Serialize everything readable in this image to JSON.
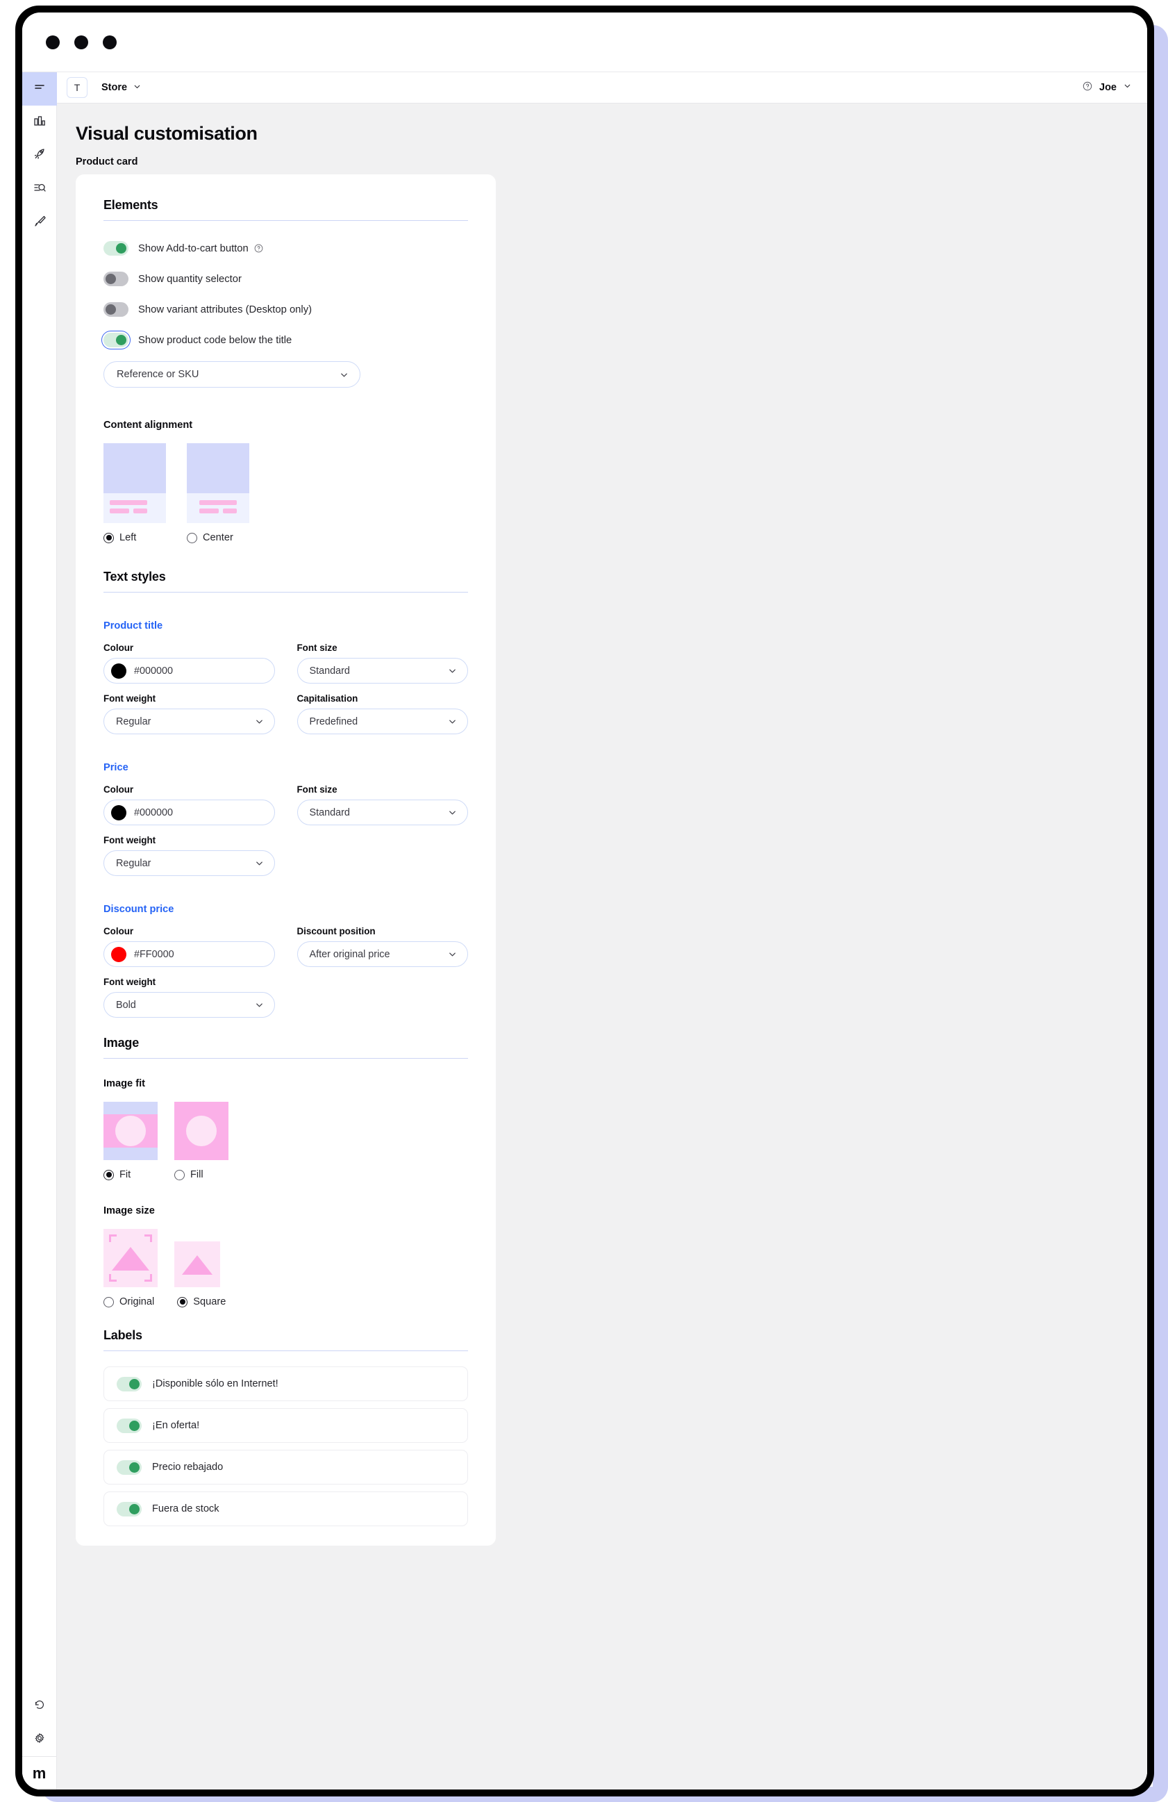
{
  "browser": {
    "dots": 3
  },
  "topbar": {
    "store_initial": "T",
    "store_label": "Store",
    "user_name": "Joe",
    "help_icon": "question-circle-icon",
    "chevron_icon": "chevron-down-icon"
  },
  "rail": {
    "items": [
      {
        "icon": "menu-icon",
        "active": true
      },
      {
        "icon": "bar-chart-icon",
        "active": false
      },
      {
        "icon": "rocket-icon",
        "active": false
      },
      {
        "icon": "search-list-icon",
        "active": false
      },
      {
        "icon": "paintbrush-icon",
        "active": false
      }
    ],
    "bottom": [
      {
        "icon": "history-icon"
      },
      {
        "icon": "gear-icon"
      }
    ],
    "brand": "m"
  },
  "page": {
    "title": "Visual customisation",
    "subtitle": "Product card"
  },
  "elements": {
    "title": "Elements",
    "toggles": [
      {
        "label": "Show Add-to-cart button",
        "on": true,
        "help": true,
        "focused": false
      },
      {
        "label": "Show quantity selector",
        "on": false,
        "help": false,
        "focused": false
      },
      {
        "label": "Show variant attributes (Desktop only)",
        "on": false,
        "help": false,
        "focused": false
      },
      {
        "label": "Show product code below the title",
        "on": true,
        "help": false,
        "focused": true
      }
    ],
    "product_code_select": "Reference or SKU"
  },
  "content_alignment": {
    "title": "Content alignment",
    "options": [
      {
        "label": "Left",
        "selected": true
      },
      {
        "label": "Center",
        "selected": false
      }
    ]
  },
  "text_styles": {
    "title": "Text styles",
    "groups": [
      {
        "name": "Product title",
        "colour_label": "Colour",
        "colour_value": "#000000",
        "colour_hex": "#000000",
        "font_size_label": "Font size",
        "font_size_value": "Standard",
        "font_weight_label": "Font weight",
        "font_weight_value": "Regular",
        "extra_label": "Capitalisation",
        "extra_value": "Predefined"
      },
      {
        "name": "Price",
        "colour_label": "Colour",
        "colour_value": "#000000",
        "colour_hex": "#000000",
        "font_size_label": "Font size",
        "font_size_value": "Standard",
        "font_weight_label": "Font weight",
        "font_weight_value": "Regular"
      },
      {
        "name": "Discount price",
        "colour_label": "Colour",
        "colour_value": "#FF0000",
        "colour_hex": "#FF0000",
        "position_label": "Discount position",
        "position_value": "After original price",
        "font_weight_label": "Font weight",
        "font_weight_value": "Bold"
      }
    ]
  },
  "image": {
    "title": "Image",
    "fit_label": "Image fit",
    "fit_options": [
      {
        "label": "Fit",
        "selected": true
      },
      {
        "label": "Fill",
        "selected": false
      }
    ],
    "size_label": "Image size",
    "size_options": [
      {
        "label": "Original",
        "selected": false
      },
      {
        "label": "Square",
        "selected": true
      }
    ]
  },
  "labels": {
    "title": "Labels",
    "items": [
      {
        "label": "¡Disponible sólo en Internet!",
        "on": true
      },
      {
        "label": "¡En oferta!",
        "on": true
      },
      {
        "label": "Precio rebajado",
        "on": true
      },
      {
        "label": "Fuera de stock",
        "on": true
      }
    ]
  },
  "colors": {
    "accent_blue": "#2563f5",
    "toggle_on": "#2f9e5f",
    "toggle_on_track": "#d6ede0",
    "toggle_off": "#6b6b72",
    "rail_active": "#ccd5fb",
    "preview_blue": "#d3d8fa",
    "preview_pink": "#fbb0e8"
  }
}
